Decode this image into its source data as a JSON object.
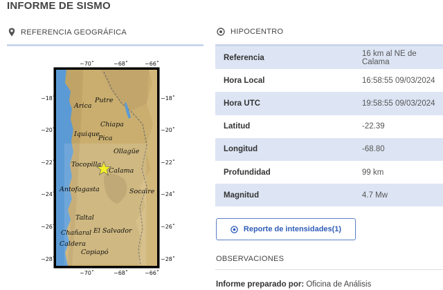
{
  "page_title": "INFORME DE SISMO",
  "left_section": {
    "label": "REFERENCIA GEOGRÁFICA",
    "icon": "map-pin-icon"
  },
  "right_section": {
    "label": "HIPOCENTRO",
    "icon": "target-icon"
  },
  "map": {
    "top_ticks": [
      "−70˚",
      "−68˚",
      "−66˚"
    ],
    "bottom_ticks": [
      "−70˚",
      "−68˚",
      "−66˚"
    ],
    "left_ticks": [
      "−18˚",
      "−20˚",
      "−22˚",
      "−24˚",
      "−26˚",
      "−28˚"
    ],
    "right_ticks": [
      "−18˚",
      "−20˚",
      "−22˚",
      "−24˚",
      "−26˚",
      "−28˚"
    ],
    "places": [
      "Arica",
      "Putre",
      "Chiapa",
      "Iquique",
      "Pica",
      "Ollagüe",
      "Tocopilla",
      "Calama",
      "Antofagasta",
      "Socaire",
      "Taltal",
      "Chañaral",
      "El Salvador",
      "Caldera",
      "Copiapó"
    ],
    "epicenter_icon": "star-icon"
  },
  "hipocentro": [
    {
      "key": "Referencia",
      "value": "16 km al NE de Calama"
    },
    {
      "key": "Hora Local",
      "value": "16:58:55 09/03/2024"
    },
    {
      "key": "Hora UTC",
      "value": "19:58:55 09/03/2024"
    },
    {
      "key": "Latitud",
      "value": "-22.39"
    },
    {
      "key": "Longitud",
      "value": "-68.80"
    },
    {
      "key": "Profundidad",
      "value": "99 km"
    },
    {
      "key": "Magnitud",
      "value": "4.7 Mw"
    }
  ],
  "report_button": {
    "label": "Reporte de intensidades(1)",
    "icon": "radio-circle-icon"
  },
  "observaciones_label": "OBSERVACIONES",
  "prepared": {
    "label": "Informe preparado por:",
    "value": "Oficina de Análisis"
  },
  "colors": {
    "row_highlight": "#dde5f4",
    "button_accent": "#2f5cb8",
    "ocean": "#5b9ad4",
    "land": "#cfb57a",
    "star": "#f4f02a"
  }
}
